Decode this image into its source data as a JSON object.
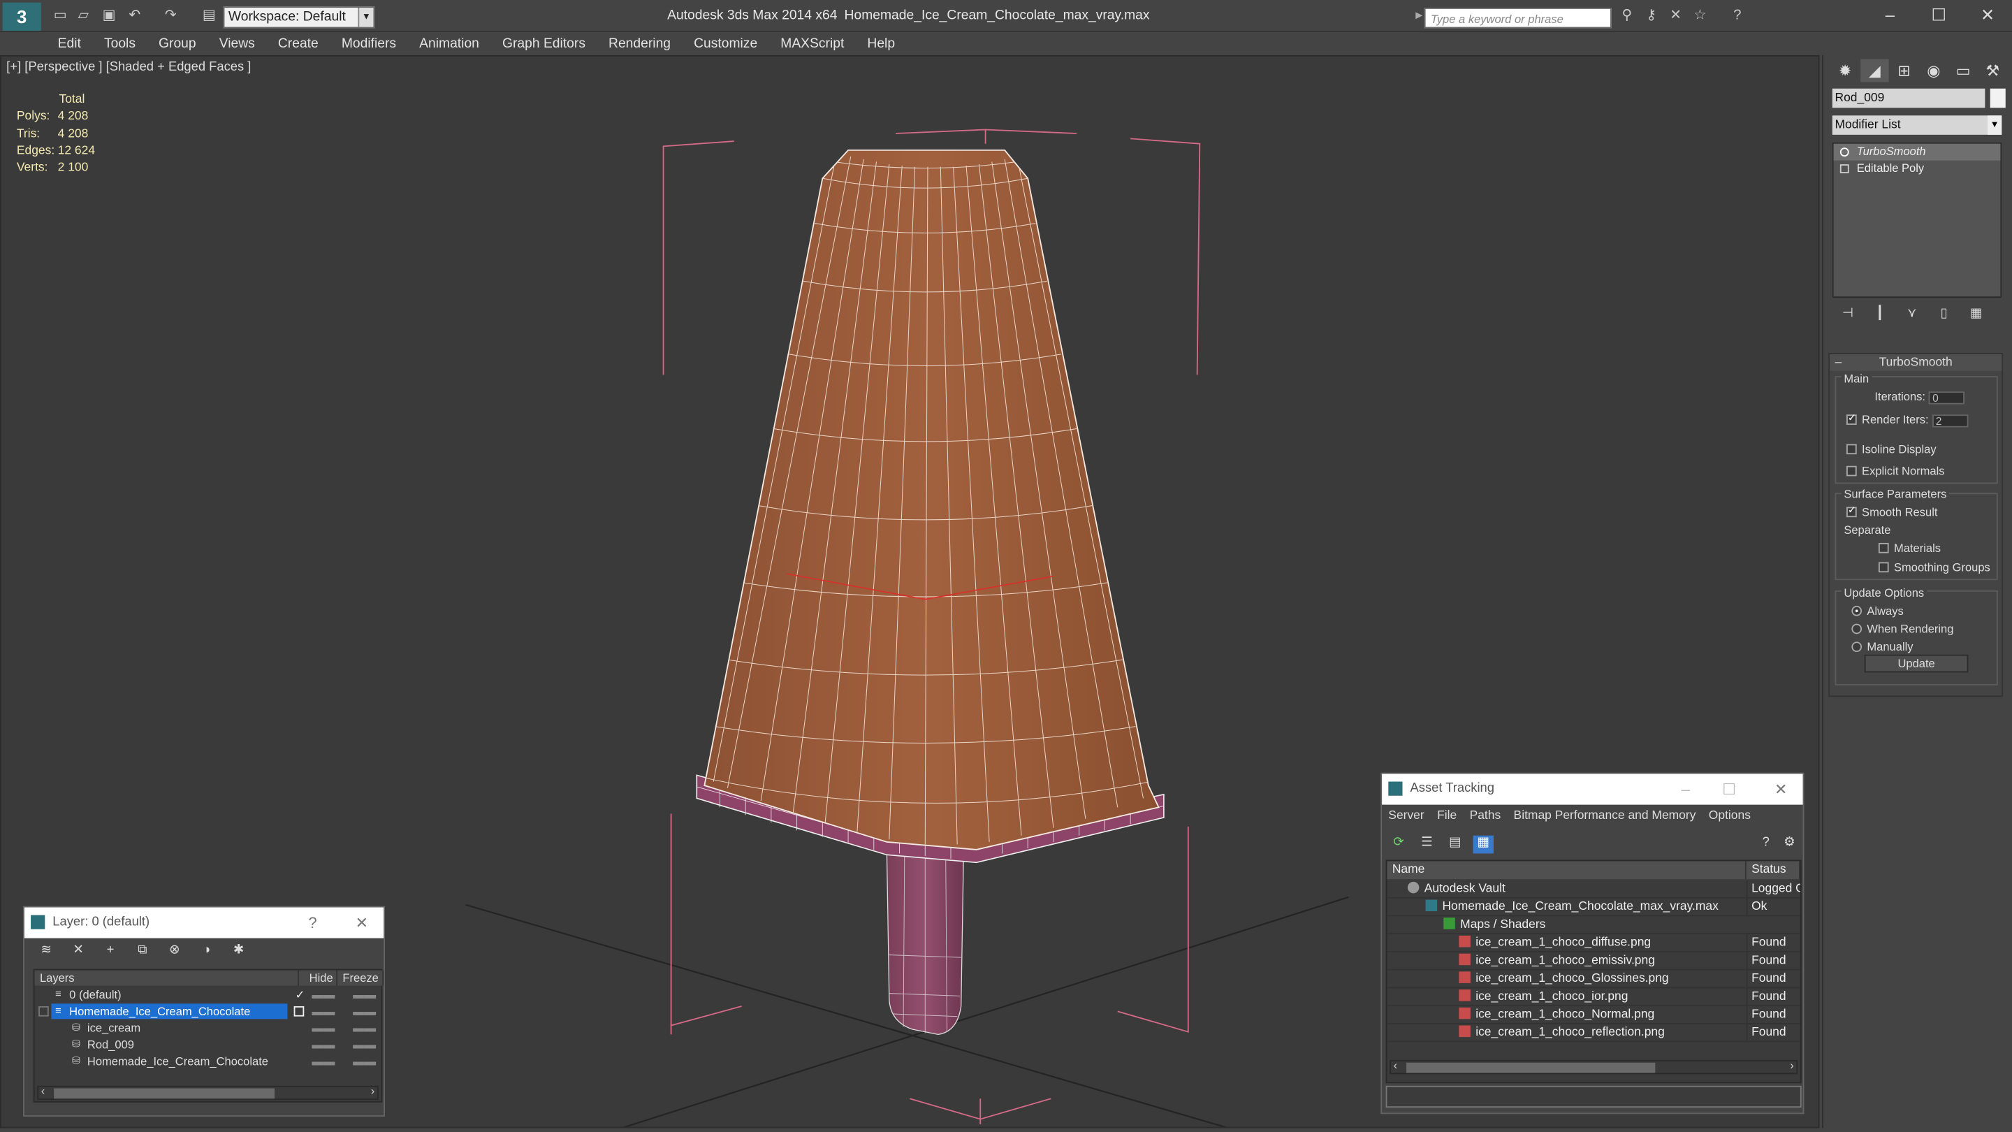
{
  "app": {
    "name": "Autodesk 3ds Max  2014 x64",
    "file": "Homemade_Ice_Cream_Chocolate_max_vray.max",
    "workspace": "Workspace: Default",
    "search_placeholder": "Type a keyword or phrase"
  },
  "menu": [
    "Edit",
    "Tools",
    "Group",
    "Views",
    "Create",
    "Modifiers",
    "Animation",
    "Graph Editors",
    "Rendering",
    "Customize",
    "MAXScript",
    "Help"
  ],
  "viewport": {
    "label": "[+] [Perspective ] [Shaded + Edged Faces ]",
    "stats": {
      "header": "Total",
      "polys_label": "Polys:",
      "polys": "4 208",
      "tris_label": "Tris:",
      "tris": "4 208",
      "edges_label": "Edges:",
      "edges": "12 624",
      "verts_label": "Verts:",
      "verts": "2 100"
    }
  },
  "command_panel": {
    "object_name": "Rod_009",
    "modifier_list": "Modifier List",
    "stack": [
      "TurboSmooth",
      "Editable Poly"
    ],
    "rollout_title": "TurboSmooth",
    "main_label": "Main",
    "iterations_label": "Iterations:",
    "iterations": "0",
    "render_iters_label": "Render Iters:",
    "render_iters": "2",
    "isoline": "Isoline Display",
    "explicit": "Explicit Normals",
    "surface_label": "Surface Parameters",
    "smooth_result": "Smooth Result",
    "separate_label": "Separate",
    "materials": "Materials",
    "smoothing_groups": "Smoothing Groups",
    "update_options_label": "Update Options",
    "always": "Always",
    "when_rendering": "When Rendering",
    "manually": "Manually",
    "update_button": "Update"
  },
  "layer_window": {
    "title": "Layer: 0 (default)",
    "help": "?",
    "col_layers": "Layers",
    "col_hide": "Hide",
    "col_freeze": "Freeze",
    "rows": [
      {
        "name": "0 (default)",
        "indent": 0,
        "selected": false
      },
      {
        "name": "Homemade_Ice_Cream_Chocolate",
        "indent": 0,
        "selected": true
      },
      {
        "name": "ice_cream",
        "indent": 1,
        "selected": false
      },
      {
        "name": "Rod_009",
        "indent": 1,
        "selected": false
      },
      {
        "name": "Homemade_Ice_Cream_Chocolate",
        "indent": 1,
        "selected": false
      }
    ]
  },
  "asset_window": {
    "title": "Asset Tracking",
    "menu": [
      "Server",
      "File",
      "Paths",
      "Bitmap Performance and Memory",
      "Options"
    ],
    "col_name": "Name",
    "col_status": "Status",
    "rows": [
      {
        "name": "Autodesk Vault",
        "status": "Logged O",
        "indent": 1
      },
      {
        "name": "Homemade_Ice_Cream_Chocolate_max_vray.max",
        "status": "Ok",
        "indent": 2
      },
      {
        "name": "Maps / Shaders",
        "status": "",
        "indent": 3
      },
      {
        "name": "ice_cream_1_choco_diffuse.png",
        "status": "Found",
        "indent": 4
      },
      {
        "name": "ice_cream_1_choco_emissiv.png",
        "status": "Found",
        "indent": 4
      },
      {
        "name": "ice_cream_1_choco_Glossines.png",
        "status": "Found",
        "indent": 4
      },
      {
        "name": "ice_cream_1_choco_ior.png",
        "status": "Found",
        "indent": 4
      },
      {
        "name": "ice_cream_1_choco_Normal.png",
        "status": "Found",
        "indent": 4
      },
      {
        "name": "ice_cream_1_choco_reflection.png",
        "status": "Found",
        "indent": 4
      }
    ]
  }
}
